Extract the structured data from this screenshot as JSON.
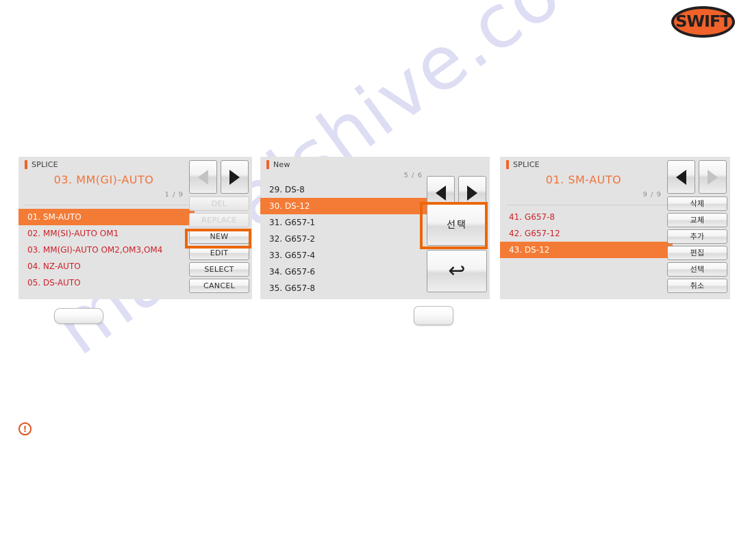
{
  "brand": {
    "logo_text": "SWIFT",
    "logo_color": "#f0622a",
    "logo_outline": "#231f20"
  },
  "watermark": {
    "text": "manualshive.com",
    "color": "#c9c9ee"
  },
  "accent": {
    "orange": "#f0622a",
    "selected_row": "#f47b35",
    "highlight_ring": "#ec6608",
    "list_text_red": "#cc2128"
  },
  "screens": [
    {
      "id": "splice-mode-list",
      "title": "SPLICE",
      "heading": "03. MM(GI)-AUTO",
      "page": "1 / 9",
      "list": [
        {
          "label": "01. SM-AUTO",
          "selected": true
        },
        {
          "label": "02. MM(SI)-AUTO OM1",
          "selected": false
        },
        {
          "label": "03. MM(GI)-AUTO OM2,OM3,OM4",
          "selected": false
        },
        {
          "label": "04. NZ-AUTO",
          "selected": false
        },
        {
          "label": "05. DS-AUTO",
          "selected": false
        }
      ],
      "nav": {
        "prev": "prev-arrow-icon",
        "next": "next-arrow-icon",
        "prev_enabled": false,
        "next_enabled": true
      },
      "buttons": [
        {
          "label": "DEL",
          "enabled": false,
          "highlighted": false
        },
        {
          "label": "REPLACE",
          "enabled": false,
          "highlighted": false
        },
        {
          "label": "NEW",
          "enabled": true,
          "highlighted": true
        },
        {
          "label": "EDIT",
          "enabled": true,
          "highlighted": false
        },
        {
          "label": "SELECT",
          "enabled": true,
          "highlighted": false
        },
        {
          "label": "CANCEL",
          "enabled": true,
          "highlighted": false
        }
      ]
    },
    {
      "id": "new-fiber-list",
      "title": "New",
      "page": "5 / 6",
      "list": [
        {
          "label": "29. DS-8",
          "selected": false
        },
        {
          "label": "30. DS-12",
          "selected": true
        },
        {
          "label": "31. G657-1",
          "selected": false
        },
        {
          "label": "32. G657-2",
          "selected": false
        },
        {
          "label": "33. G657-4",
          "selected": false
        },
        {
          "label": "34. G657-6",
          "selected": false
        },
        {
          "label": "35. G657-8",
          "selected": false
        }
      ],
      "nav": {
        "prev": "prev-arrow-icon",
        "next": "next-arrow-icon",
        "prev_enabled": true,
        "next_enabled": true
      },
      "select_button": {
        "label": "선택",
        "highlighted": true
      },
      "back_button": {
        "icon": "return-arrow-icon",
        "glyph": "↩"
      }
    },
    {
      "id": "splice-mode-list-page9",
      "title": "SPLICE",
      "heading": "01. SM-AUTO",
      "page": "9 / 9",
      "list": [
        {
          "label": "41. G657-8",
          "selected": false
        },
        {
          "label": "42. G657-12",
          "selected": false
        },
        {
          "label": "43. DS-12",
          "selected": true
        }
      ],
      "nav": {
        "prev": "prev-arrow-icon",
        "next": "next-arrow-icon",
        "prev_enabled": true,
        "next_enabled": false
      },
      "buttons": [
        {
          "label": "삭제",
          "enabled": true,
          "highlighted": false
        },
        {
          "label": "교체",
          "enabled": true,
          "highlighted": false
        },
        {
          "label": "추가",
          "enabled": true,
          "highlighted": false
        },
        {
          "label": "편집",
          "enabled": true,
          "highlighted": false
        },
        {
          "label": "선택",
          "enabled": true,
          "highlighted": false
        },
        {
          "label": "취소",
          "enabled": true,
          "highlighted": false
        }
      ]
    }
  ],
  "blank_buttons": [
    {
      "label": ""
    },
    {
      "label": ""
    }
  ],
  "note_icon": {
    "name": "warning-exclamation-icon",
    "glyph": "!"
  }
}
